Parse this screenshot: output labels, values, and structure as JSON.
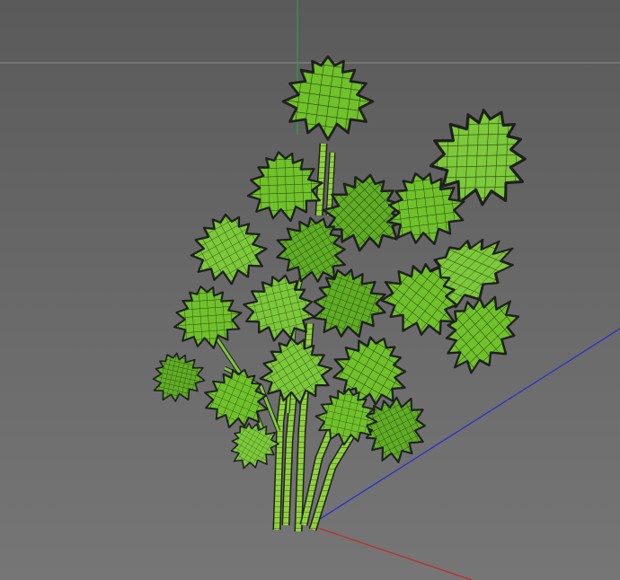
{
  "viewport": {
    "kind": "3d-viewport",
    "background_top": "#5a5a5a",
    "background_bottom": "#767676",
    "display_mode": "wireframe-shaded"
  },
  "grid": {
    "horizon_line_color": "#8c8c8c"
  },
  "axes": {
    "x_axis_color": "#c62828",
    "y_axis_color": "#2e9e3e",
    "z_axis_color": "#2a2ad0"
  },
  "model": {
    "subject": "parsley-plant",
    "leaf_fill": "#6fc22a",
    "leaf_fill_light": "#8fd23c",
    "leaf_fill_dark": "#4e9a1c",
    "mesh_color": "#2a3a14",
    "outline_color": "#1f1f1f",
    "stem_fill": "#7cc93a"
  },
  "icons": {
    "gizmo": "axis-gizmo-icon"
  }
}
